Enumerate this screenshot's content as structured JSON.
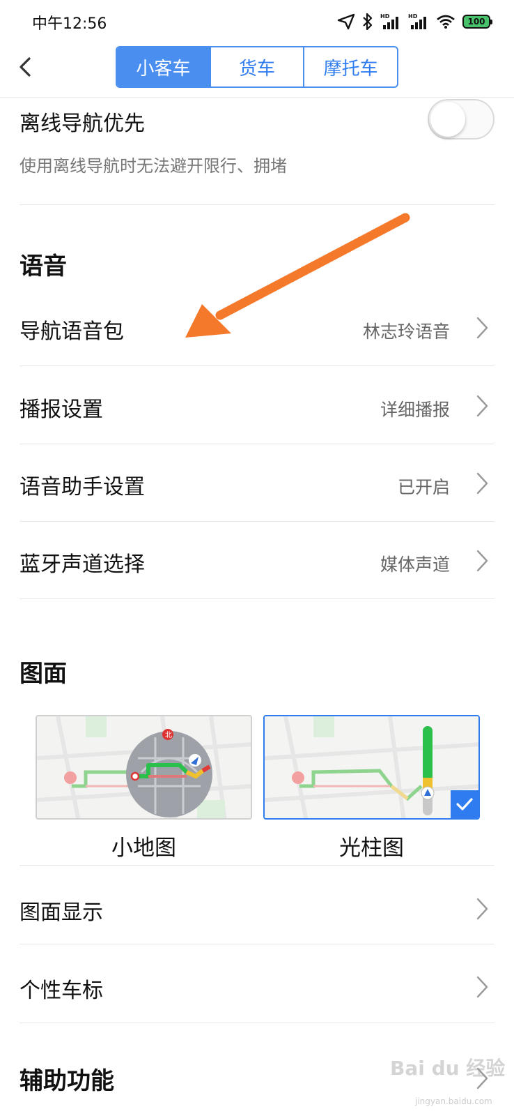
{
  "status_bar": {
    "time": "中午12:56",
    "battery": "100",
    "icons": [
      "location-icon",
      "bluetooth-icon",
      "hd-signal-icon",
      "hd-signal-icon",
      "wifi-icon",
      "battery-icon"
    ]
  },
  "header": {
    "back_icon": "back-arrow-icon",
    "tabs": [
      {
        "label": "小客车",
        "active": true
      },
      {
        "label": "货车",
        "active": false
      },
      {
        "label": "摩托车",
        "active": false
      }
    ]
  },
  "offline_nav": {
    "title": "离线导航优先",
    "description": "使用离线导航时无法避开限行、拥堵",
    "enabled": false
  },
  "voice_section": {
    "title": "语音",
    "rows": [
      {
        "label": "导航语音包",
        "value": "林志玲语音"
      },
      {
        "label": "播报设置",
        "value": "详细播报"
      },
      {
        "label": "语音助手设置",
        "value": "已开启"
      },
      {
        "label": "蓝牙声道选择",
        "value": "媒体声道"
      }
    ]
  },
  "display_section": {
    "title": "图面",
    "options": [
      {
        "label": "小地图",
        "selected": false
      },
      {
        "label": "光柱图",
        "selected": true
      }
    ],
    "rows": [
      {
        "label": "图面显示"
      },
      {
        "label": "个性车标"
      }
    ]
  },
  "assist_section": {
    "title": "辅助功能"
  },
  "watermark": {
    "text": "Bai du 经验",
    "sub": "jingyan.baidu.com"
  },
  "colors": {
    "accent": "#4a8fef",
    "annotation_arrow": "#f5792a"
  }
}
